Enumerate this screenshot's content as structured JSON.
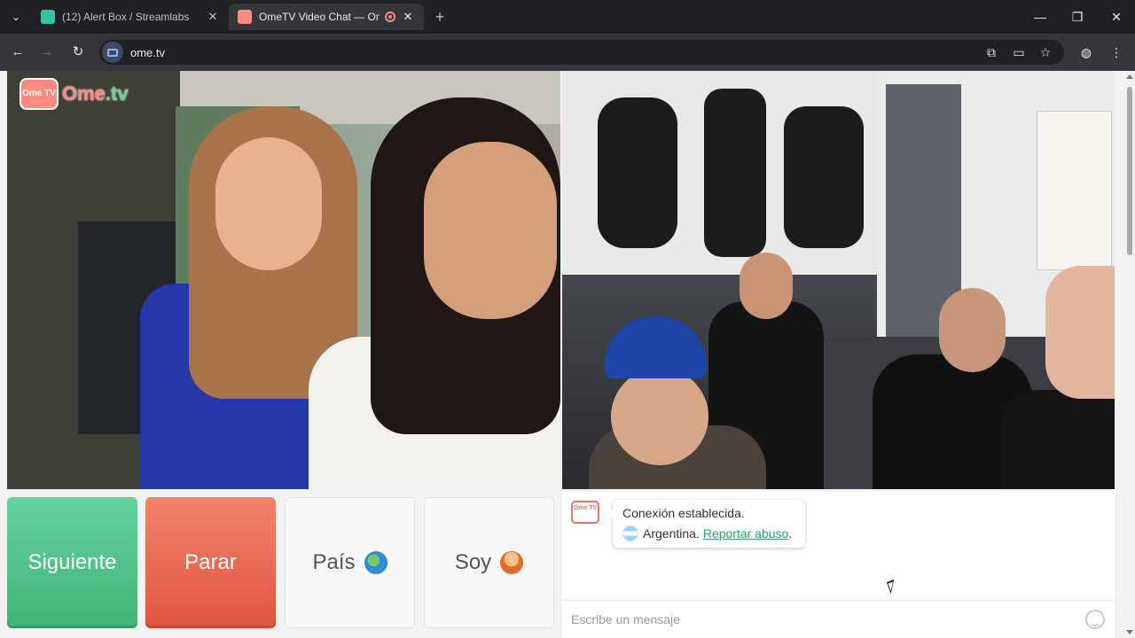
{
  "browser": {
    "tabs": [
      {
        "title": "(12) Alert Box / Streamlabs",
        "favicon": "streamlabs-icon",
        "active": false
      },
      {
        "title": "OmeTV Video Chat — Ome",
        "favicon": "ometv-icon",
        "active": true,
        "recording": true
      }
    ],
    "url": "ome.tv",
    "colors": {
      "chrome_dark": "#202124",
      "toolbar": "#35363a"
    }
  },
  "page": {
    "logo": {
      "badge": "Ome TV",
      "text_a": "Ome",
      "text_b": ".tv"
    },
    "buttons": {
      "next": "Siguiente",
      "stop": "Parar",
      "country": "País",
      "gender": "Soy"
    },
    "chat": {
      "logo_badge": "Ome TV",
      "status": "Conexión establecida.",
      "country": "Argentina.",
      "report_link": "Reportar abuso",
      "report_suffix": ".",
      "input_placeholder": "Escribe un mensaje"
    },
    "colors": {
      "next_green": "#43b37c",
      "stop_red": "#e0563f",
      "link_green": "#2f9d66"
    }
  }
}
